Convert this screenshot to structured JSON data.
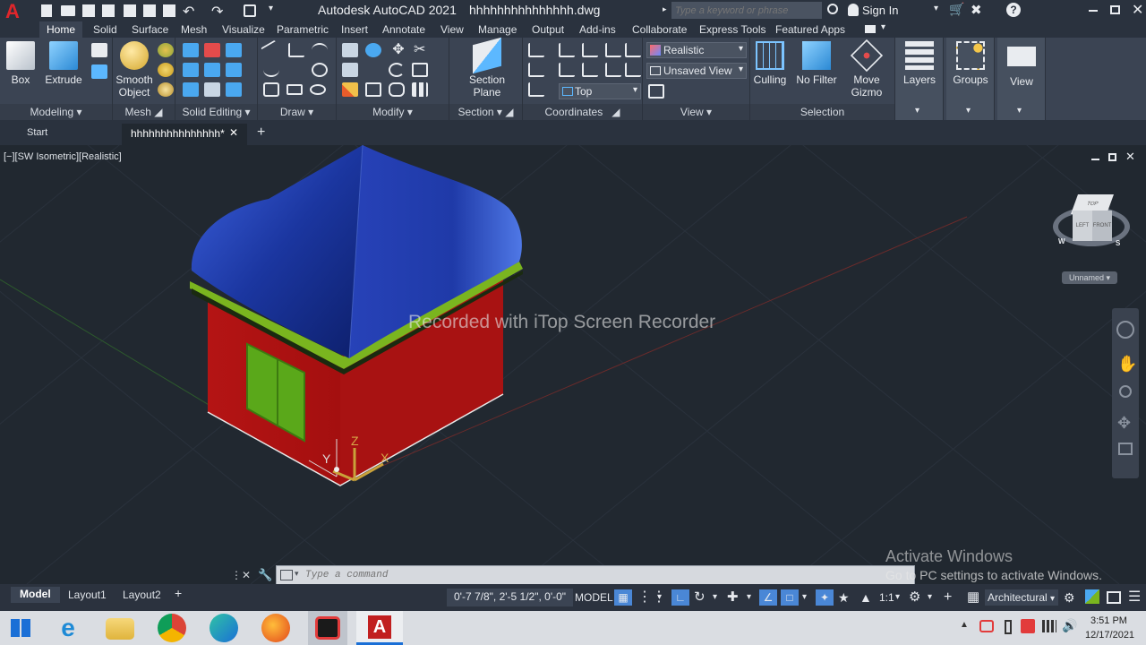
{
  "titlebar": {
    "app_title": "Autodesk AutoCAD 2021",
    "file_name": "hhhhhhhhhhhhhhh.dwg",
    "search_placeholder": "Type a keyword or phrase",
    "sign_in": "Sign In"
  },
  "ribbon_tabs": [
    "Home",
    "Solid",
    "Surface",
    "Mesh",
    "Visualize",
    "Parametric",
    "Insert",
    "Annotate",
    "View",
    "Manage",
    "Output",
    "Add-ins",
    "Collaborate",
    "Express Tools",
    "Featured Apps"
  ],
  "ribbon": {
    "modeling": {
      "box": "Box",
      "extrude": "Extrude",
      "title": "Modeling"
    },
    "mesh": {
      "smooth_object_1": "Smooth",
      "smooth_object_2": "Object",
      "title": "Mesh"
    },
    "solid_editing": {
      "title": "Solid Editing"
    },
    "draw": {
      "title": "Draw"
    },
    "modify": {
      "title": "Modify"
    },
    "section": {
      "section_plane_1": "Section",
      "section_plane_2": "Plane",
      "title": "Section"
    },
    "coordinates": {
      "ucs_top": "Top",
      "title": "Coordinates"
    },
    "view": {
      "visual_style": "Realistic",
      "named_view": "Unsaved View",
      "title": "View"
    },
    "selection": {
      "culling": "Culling",
      "no_filter": "No Filter",
      "move_gizmo_1": "Move",
      "move_gizmo_2": "Gizmo",
      "title": "Selection"
    },
    "layers": "Layers",
    "groups": "Groups",
    "view_btn": "View"
  },
  "doc_tabs": {
    "start": "Start",
    "drawing": "hhhhhhhhhhhhhhh*"
  },
  "viewport": {
    "label": "[−][SW Isometric][Realistic]",
    "watermark": "Recorded with iTop Screen Recorder",
    "ucs_x": "X",
    "ucs_y": "Y",
    "ucs_z": "Z",
    "viewcube_top": "TOP",
    "viewcube_left": "LEFT",
    "viewcube_front": "FRONT",
    "compass_w": "W",
    "compass_s": "S",
    "wcs_label": "Unnamed",
    "activate_title": "Activate Windows",
    "activate_sub": "Go to PC settings to activate Windows."
  },
  "command": {
    "placeholder": "Type a command"
  },
  "status": {
    "model_tab": "Model",
    "layout1": "Layout1",
    "layout2": "Layout2",
    "coords": "0'-7 7/8\", 2'-5 1/2\", 0'-0\"",
    "model": "MODEL",
    "scale": "1:1",
    "units": "Architectural"
  },
  "taskbar": {
    "time": "3:51 PM",
    "date": "12/17/2021"
  },
  "colors": {
    "roof": "#1f3fa8",
    "walls": "#b01313",
    "trim": "#7ab51f",
    "window": "#5aa81a",
    "background": "#212830",
    "ribbon": "#3b4453"
  }
}
